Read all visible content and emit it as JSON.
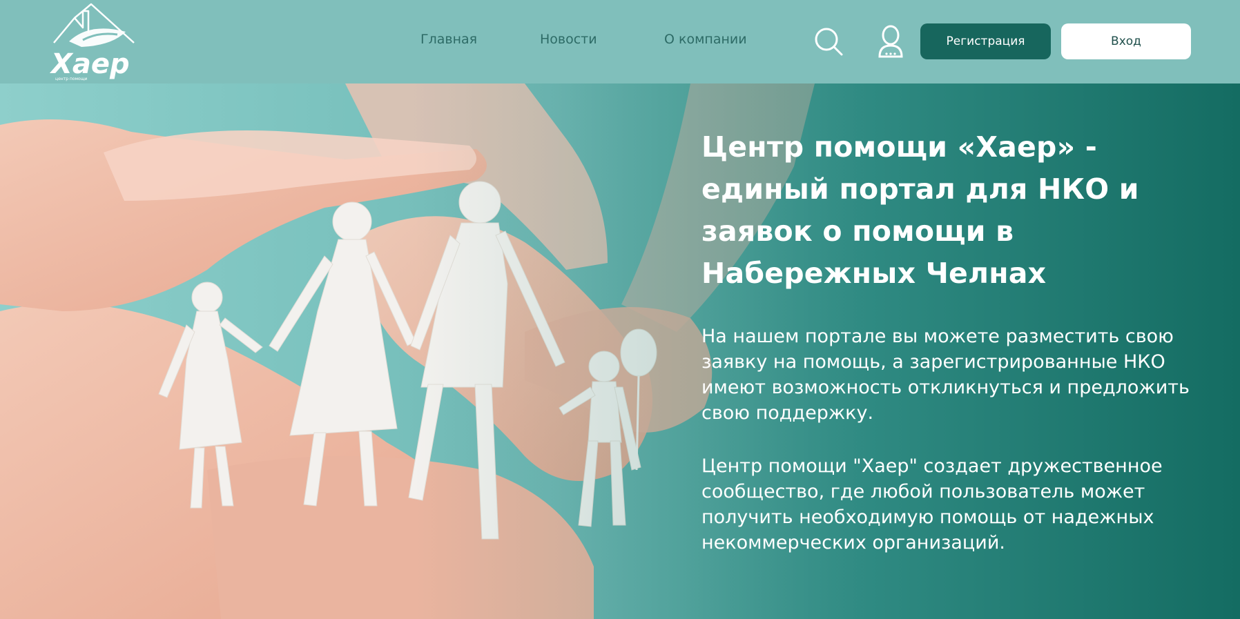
{
  "header": {
    "logo_text": "Хаер",
    "logo_subtext": "центр помощи",
    "nav": {
      "home": "Главная",
      "news": "Новости",
      "about": "О компании"
    },
    "register_label": "Регистрация",
    "login_label": "Вход",
    "icons": {
      "search": "search-icon",
      "user": "user-icon"
    }
  },
  "hero": {
    "title": "Центр помощи «Хаер» - единый портал для НКО и заявок о помощи в Набережных Челнах",
    "paragraph1": "На нашем портале вы можете разместить свою заявку на помощь, а зарегистрированные НКО имеют возможность откликнуться и предложить свою поддержку.",
    "paragraph2": "Центр помощи \"Хаер\" создает дружественное сообщество, где любой пользователь может получить необходимую помощь от надежных некоммерческих организаций."
  },
  "colors": {
    "header_bg": "#80bfbb",
    "primary_button": "#17665d",
    "nav_text": "#2d6b66"
  }
}
